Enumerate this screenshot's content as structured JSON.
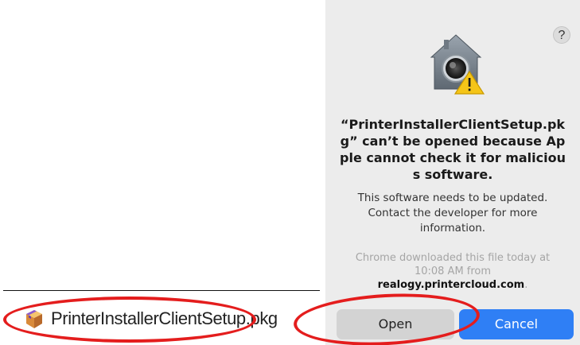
{
  "download_shelf": {
    "file_name": "PrinterInstallerClientSetup.pkg",
    "file_icon": "package-icon"
  },
  "dialog": {
    "help_label": "?",
    "icon": "gatekeeper-warning-icon",
    "title": "“PrinterInstallerClientSetup.pkg” can’t be opened because Apple cannot check it for malicious software.",
    "message": "This software needs to be updated. Contact the developer for more information.",
    "note_prefix": "Chrome downloaded this file today at 10:08 AM from",
    "note_domain": "realogy.printercloud.com",
    "note_suffix": ".",
    "buttons": {
      "open": "Open",
      "cancel": "Cancel"
    }
  },
  "colors": {
    "dialog_background": "#ececec",
    "cancel_button": "#2f7ff5",
    "open_button": "#d3d3d3",
    "annotation": "#e41d1d"
  }
}
